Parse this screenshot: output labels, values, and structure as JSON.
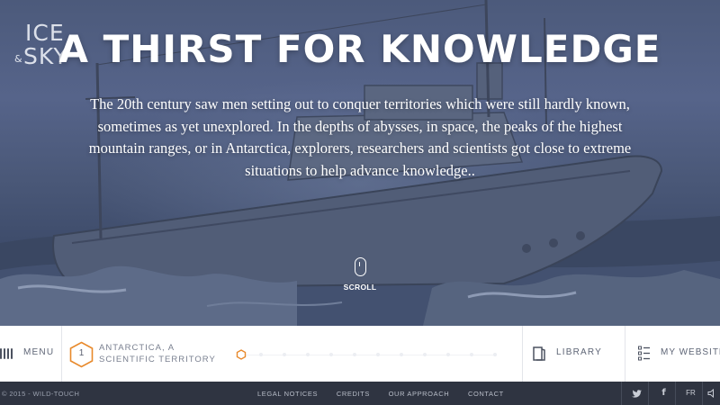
{
  "logo": {
    "ice": "ICE",
    "amp": "&",
    "sky": "SKY"
  },
  "hero": {
    "title": "A THIRST FOR KNOWLEDGE",
    "intro": "The 20th century saw men setting out to conquer territories which were still hardly known, sometimes as yet unexplored. In the depths of abysses, in space, the peaks of the highest mountain ranges, or in Antarctica, explorers, researchers and scientists got close to extreme situations to help advance knowledge..",
    "scroll_label": "SCROLL"
  },
  "nav": {
    "menu_label": "MENU",
    "chapter_number": "1",
    "chapter_title": "ANTARCTICA, A SCIENTIFIC TERRITORY",
    "library_label": "LIBRARY",
    "website_label": "MY WEBSITE",
    "accent_color": "#e8892b"
  },
  "footer": {
    "copyright": "© 2015 - WILD-TOUCH",
    "links": [
      "LEGAL NOTICES",
      "CREDITS",
      "OUR APPROACH",
      "CONTACT"
    ],
    "language": "FR",
    "icons": [
      "twitter-icon",
      "facebook-icon",
      "sound-icon"
    ]
  }
}
